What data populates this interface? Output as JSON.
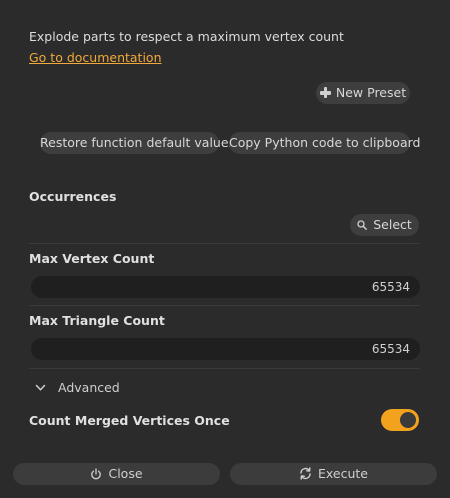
{
  "description": "Explode parts to respect a maximum vertex count",
  "documentation_link": "Go to documentation",
  "presets": {
    "new_preset_label": "New Preset"
  },
  "actions": {
    "restore_label": "Restore function default values",
    "copy_python_label": "Copy Python code to clipboard"
  },
  "occurrences": {
    "label": "Occurrences",
    "select_label": "Select"
  },
  "max_vertex_count": {
    "label": "Max Vertex Count",
    "value": "65534"
  },
  "max_triangle_count": {
    "label": "Max Triangle Count",
    "value": "65534"
  },
  "advanced": {
    "label": "Advanced",
    "expanded": false
  },
  "count_merged_vertices_once": {
    "label": "Count Merged Vertices Once",
    "enabled": true
  },
  "footer": {
    "close_label": "Close",
    "execute_label": "Execute"
  },
  "colors": {
    "background": "#2b2b2b",
    "accent": "#f2a21c",
    "link": "#f2a93b",
    "button": "#3e3e3e",
    "field": "#1f1f1f"
  },
  "icons": {
    "new_preset": "plus-icon",
    "select": "search-icon",
    "advanced": "chevron-down-icon",
    "close": "power-icon",
    "execute": "refresh-icon"
  }
}
